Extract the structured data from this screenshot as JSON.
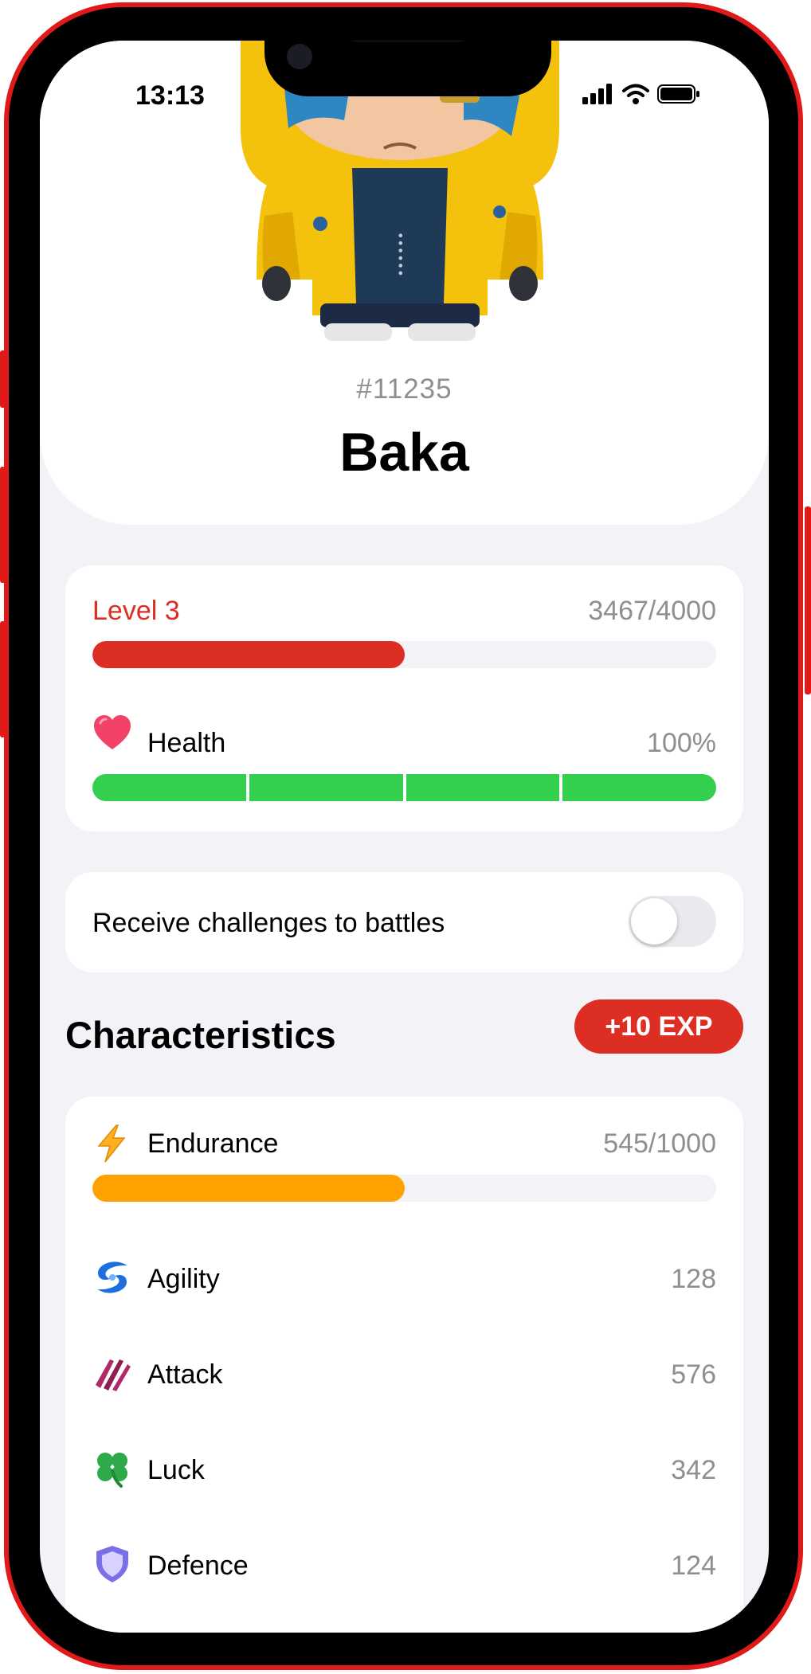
{
  "status_bar": {
    "time": "13:13"
  },
  "profile": {
    "token_id": "#11235",
    "name": "Baka"
  },
  "level_card": {
    "level_label": "Level 3",
    "xp_text": "3467/4000",
    "level_progress": 0.5,
    "health_label": "Health",
    "health_text": "100%",
    "health_segments_filled": 4,
    "health_segments_total": 4
  },
  "battle_toggle": {
    "label": "Receive challenges to battles",
    "enabled": false
  },
  "characteristics": {
    "title": "Characteristics",
    "exp_button_label": "+10 EXP",
    "endurance": {
      "label": "Endurance",
      "value_text": "545/1000",
      "progress": 0.5
    },
    "stats": [
      {
        "label": "Agility",
        "value": "128",
        "icon": "agility-icon"
      },
      {
        "label": "Attack",
        "value": "576",
        "icon": "attack-icon"
      },
      {
        "label": "Luck",
        "value": "342",
        "icon": "clover-icon"
      },
      {
        "label": "Defence",
        "value": "124",
        "icon": "shield-icon"
      }
    ]
  },
  "colors": {
    "accent_red": "#dc2e22",
    "health_green": "#34cf4f",
    "endurance_orange": "#ffa200",
    "frame_red": "#e01919"
  }
}
